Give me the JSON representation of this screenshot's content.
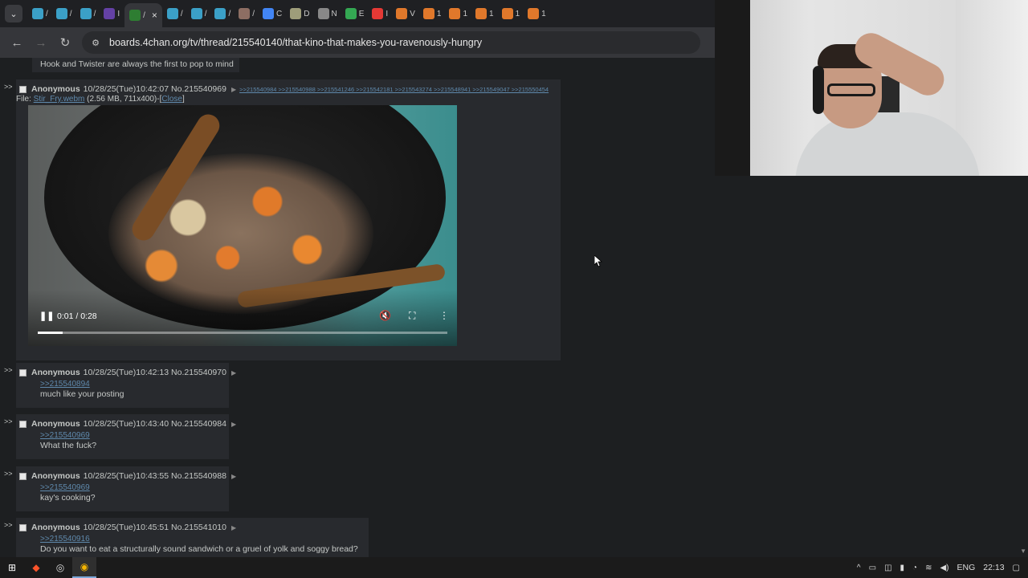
{
  "browser": {
    "url": "boards.4chan.org/tv/thread/215540140/that-kino-that-makes-you-ravenously-hungry",
    "tabs": [
      {
        "label": "/",
        "icon": "grid-icon",
        "color": "#3ba0c7"
      },
      {
        "label": "/",
        "icon": "grid-icon",
        "color": "#3ba0c7"
      },
      {
        "label": "/",
        "icon": "grid-icon",
        "color": "#3ba0c7"
      },
      {
        "label": "I",
        "icon": "twitch-icon",
        "color": "#6441a5"
      },
      {
        "label": "/",
        "icon": "clover-icon",
        "color": "#2e7d32",
        "active": true
      },
      {
        "label": "/",
        "icon": "grid-icon",
        "color": "#3ba0c7"
      },
      {
        "label": "/",
        "icon": "grid-icon",
        "color": "#3ba0c7"
      },
      {
        "label": "/",
        "icon": "grid-icon",
        "color": "#3ba0c7"
      },
      {
        "label": "/",
        "icon": "avatar-icon",
        "color": "#8d6e63"
      },
      {
        "label": "C",
        "icon": "translate-icon",
        "color": "#4285f4"
      },
      {
        "label": "D",
        "icon": "disk-icon",
        "color": "#9e9d7a"
      },
      {
        "label": "N",
        "icon": "globe-icon",
        "color": "#888888"
      },
      {
        "label": "E",
        "icon": "maps-icon",
        "color": "#34a853"
      },
      {
        "label": "I",
        "icon": "red-app-icon",
        "color": "#e53935"
      },
      {
        "label": "V",
        "icon": "basketball-icon",
        "color": "#e0782b"
      },
      {
        "label": "1",
        "icon": "basketball-icon",
        "color": "#e0782b"
      },
      {
        "label": "1",
        "icon": "basketball-icon",
        "color": "#e0782b"
      },
      {
        "label": "1",
        "icon": "basketball-icon",
        "color": "#e0782b"
      },
      {
        "label": "1",
        "icon": "basketball-icon",
        "color": "#e0782b"
      },
      {
        "label": "1",
        "icon": "basketball-icon",
        "color": "#e0782b"
      }
    ]
  },
  "thread": {
    "prev_message": "Hook and Twister are always the first to pop to mind",
    "op_post": {
      "arrows": ">>",
      "name": "Anonymous",
      "datetime": "10/28/25(Tue)10:42:07",
      "number": "No.215540969",
      "backlinks": ">>215540984 >>215540988 >>215541246 >>215542181 >>215543274 >>215548941 >>215549047 >>215550454",
      "file_prefix": "File: ",
      "file_name": "Stir_Fry.webm",
      "file_meta": " (2.56 MB, 711x400)-[",
      "file_close": "Close",
      "file_suffix": "]",
      "video_time": "0:01 / 0:28",
      "video_progress": 0.06
    },
    "replies": [
      {
        "name": "Anonymous",
        "datetime": "10/28/25(Tue)10:42:13",
        "number": "No.215540970",
        "quote": ">>215540894",
        "text": "much like your posting"
      },
      {
        "name": "Anonymous",
        "datetime": "10/28/25(Tue)10:43:40",
        "number": "No.215540984",
        "quote": ">>215540969",
        "text": "What the fuck?"
      },
      {
        "name": "Anonymous",
        "datetime": "10/28/25(Tue)10:43:55",
        "number": "No.215540988",
        "quote": ">>215540969",
        "text": "kay's cooking?"
      },
      {
        "name": "Anonymous",
        "datetime": "10/28/25(Tue)10:45:51",
        "number": "No.215541010",
        "quote": ">>215540916",
        "text": "Do you want to eat a structurally sound sandwich or a gruel of yolk and soggy bread?"
      }
    ]
  },
  "taskbar": {
    "language": "ENG",
    "clock": "22:13"
  },
  "colors": {
    "page_bg": "#1d1f21",
    "post_bg": "#282a2e",
    "link": "#5f89ac",
    "text": "#c5c8c6"
  }
}
